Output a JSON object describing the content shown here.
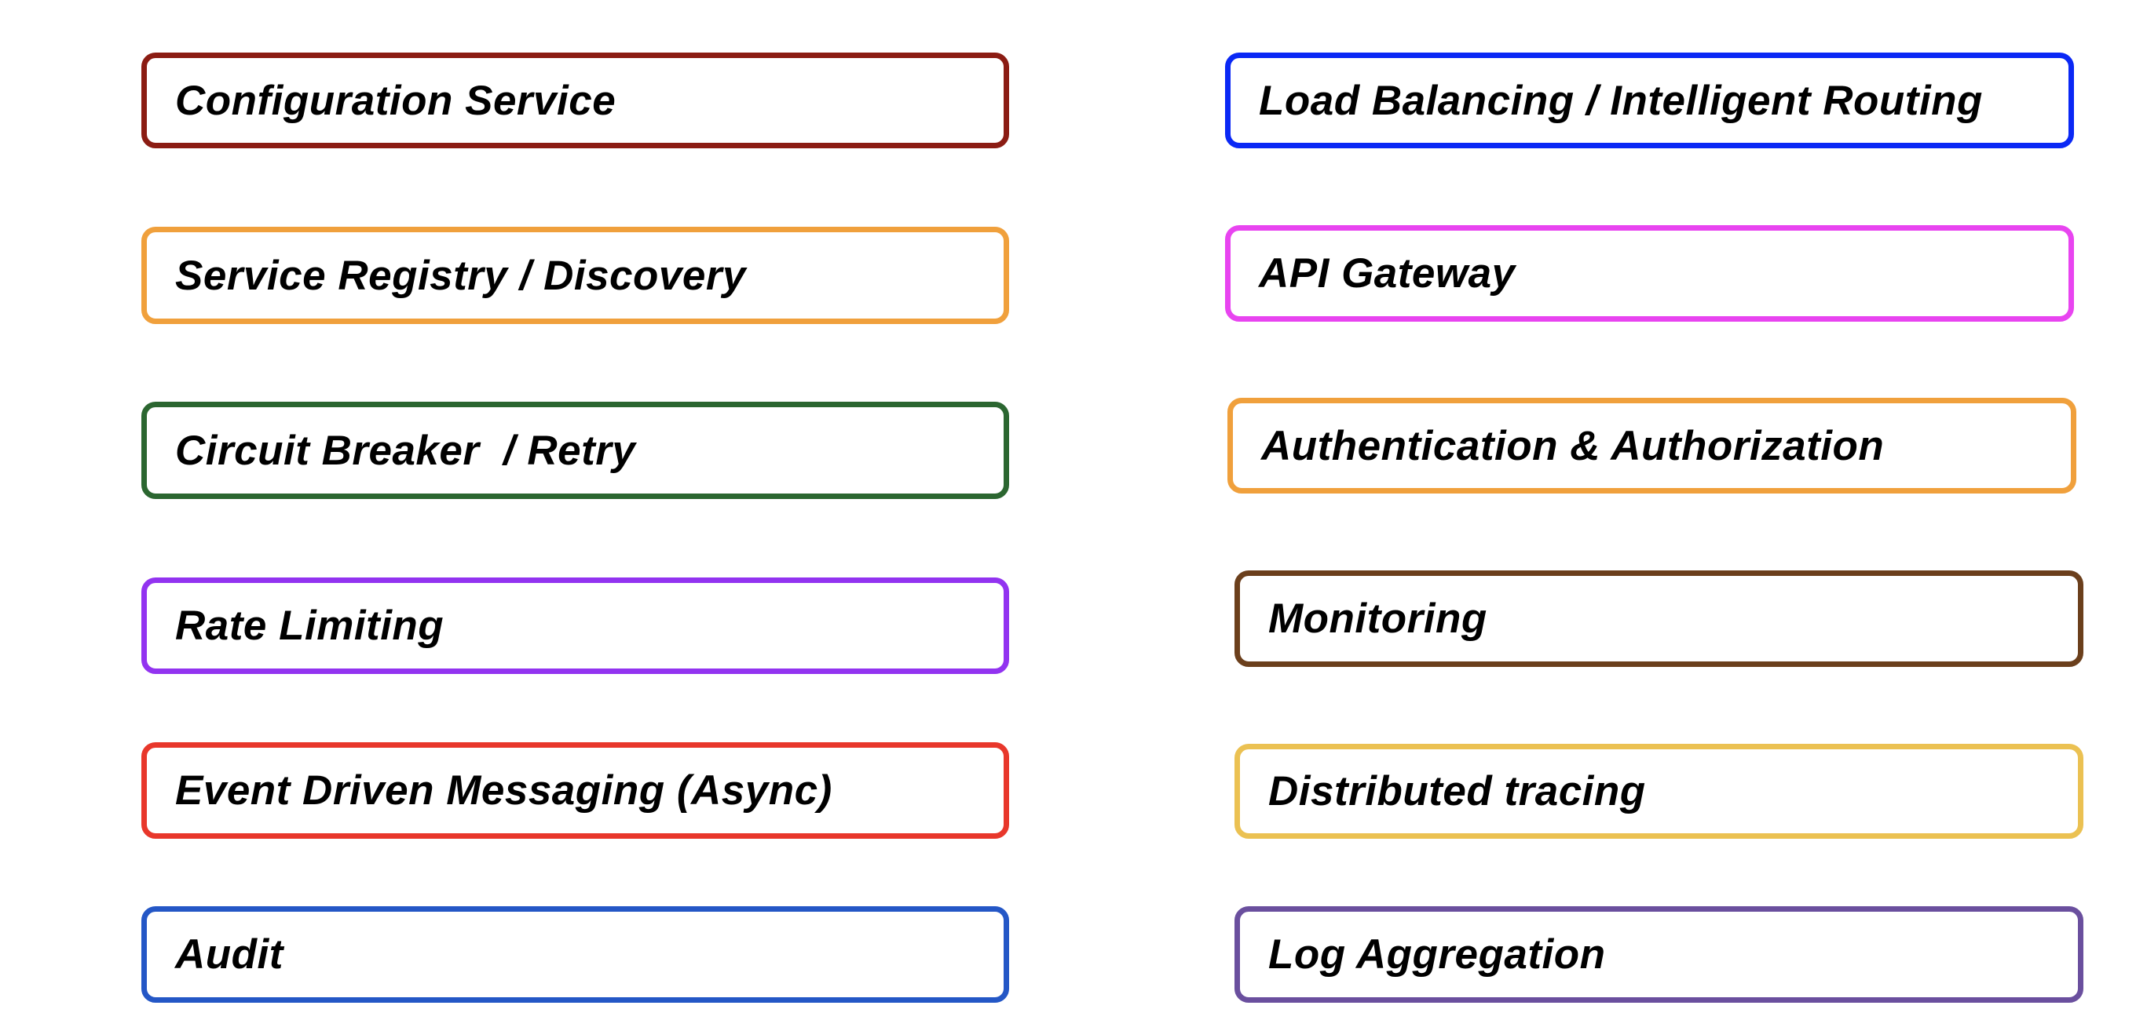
{
  "left_column": [
    {
      "label": "Configuration Service",
      "color": "#8B1C13"
    },
    {
      "label": "Service Registry / Discovery",
      "color": "#F0A03C"
    },
    {
      "label": "Circuit Breaker  / Retry",
      "color": "#2B6630"
    },
    {
      "label": "Rate Limiting",
      "color": "#9233F0"
    },
    {
      "label": "Event Driven Messaging (Async)",
      "color": "#E8372B"
    },
    {
      "label": "Audit",
      "color": "#2457C6"
    }
  ],
  "right_column": [
    {
      "label": "Load Balancing / Intelligent Routing",
      "color": "#0A28F5"
    },
    {
      "label": "API Gateway",
      "color": "#E844F0"
    },
    {
      "label": "Authentication & Authorization",
      "color": "#F0A03C"
    },
    {
      "label": "Monitoring",
      "color": "#6B3F1C"
    },
    {
      "label": "Distributed tracing",
      "color": "#EBC152"
    },
    {
      "label": "Log Aggregation",
      "color": "#6A4F9E"
    }
  ]
}
